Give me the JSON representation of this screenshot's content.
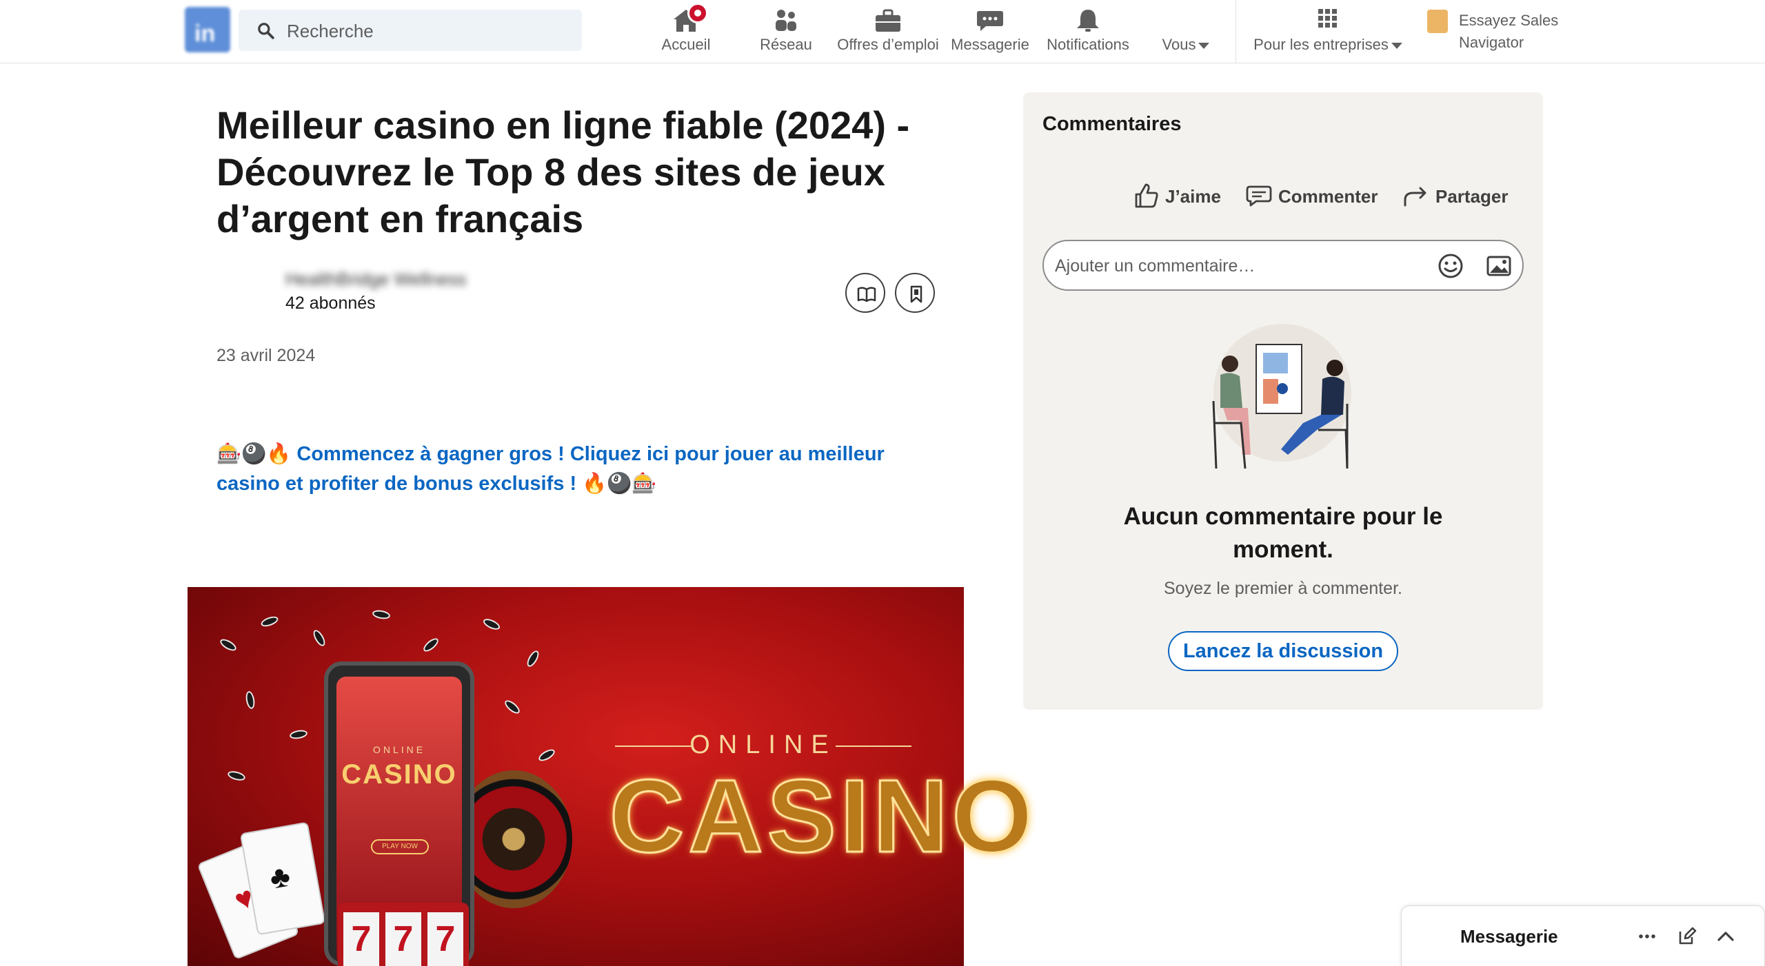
{
  "nav": {
    "search_placeholder": "Recherche",
    "items": [
      {
        "label": "Accueil",
        "icon": "home-icon"
      },
      {
        "label": "Réseau",
        "icon": "people-icon"
      },
      {
        "label": "Offres d’emploi",
        "icon": "briefcase-icon"
      },
      {
        "label": "Messagerie",
        "icon": "chat-icon"
      },
      {
        "label": "Notifications",
        "icon": "bell-icon"
      },
      {
        "label": "Vous",
        "icon": "avatar-icon"
      },
      {
        "label": "Pour les entreprises",
        "icon": "grid-icon"
      }
    ],
    "sales_navigator": "Essayez Sales Navigator",
    "brand_color": "#0a66c2",
    "badge_color": "#cb112d"
  },
  "article": {
    "title": "Meilleur casino en ligne fiable (2024) - Découvrez le Top 8 des sites de jeux d’argent en français",
    "author_name": "HealthBridge Wellness",
    "followers": "42 abonnés",
    "date": "23 avril 2024",
    "promo_emoji_start": "🎰🎱🔥",
    "promo_text": "Commencez à gagner gros ! Cliquez ici pour jouer au meilleur casino et profiter de bonus exclusifs !",
    "promo_emoji_end": "🔥🎱🎰",
    "hero": {
      "online": "ONLINE",
      "casino": "CASINO",
      "phone_online": "ONLINE",
      "phone_casino": "CASINO",
      "phone_play": "PLAY NOW",
      "slot_digits": [
        "7",
        "7",
        "7"
      ]
    }
  },
  "comments": {
    "title": "Commentaires",
    "actions": {
      "like": "J’aime",
      "comment": "Commenter",
      "share": "Partager"
    },
    "input_placeholder": "Ajouter un commentaire…",
    "empty_title": "Aucun commentaire pour le moment.",
    "empty_sub": "Soyez le premier à commenter.",
    "start_button": "Lancez la discussion"
  },
  "messaging": {
    "label": "Messagerie"
  }
}
